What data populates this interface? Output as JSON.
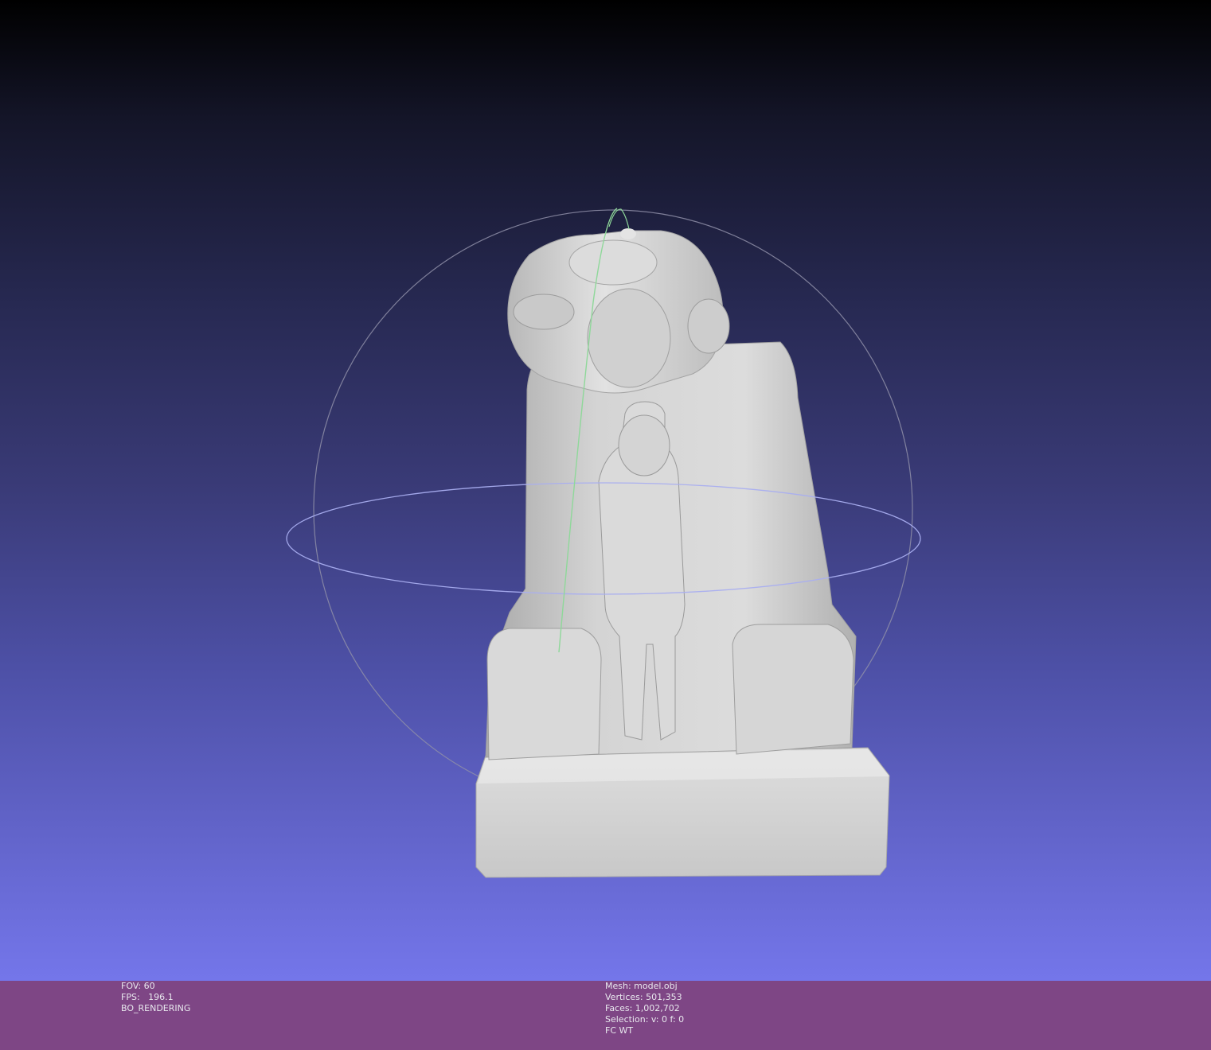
{
  "colors": {
    "background_top": "#000000",
    "background_bottom": "#7476ea",
    "info_bar": "#7e4685",
    "info_text": "#e8e8ee",
    "mesh": "#d6d6d6",
    "trackball_grey": "#8f8fa8",
    "trackball_green": "#8fd89a",
    "trackball_blue": "#a9aef0"
  },
  "info_left": {
    "fov": "FOV: 60",
    "fps": "FPS:   196.1",
    "rendering": "BO_RENDERING"
  },
  "info_right": {
    "mesh": "Mesh: model.obj",
    "vertices": "Vertices: 501,353",
    "faces": "Faces: 1,002,702",
    "selection": "Selection: v: 0 f: 0",
    "fc": "FC WT"
  }
}
